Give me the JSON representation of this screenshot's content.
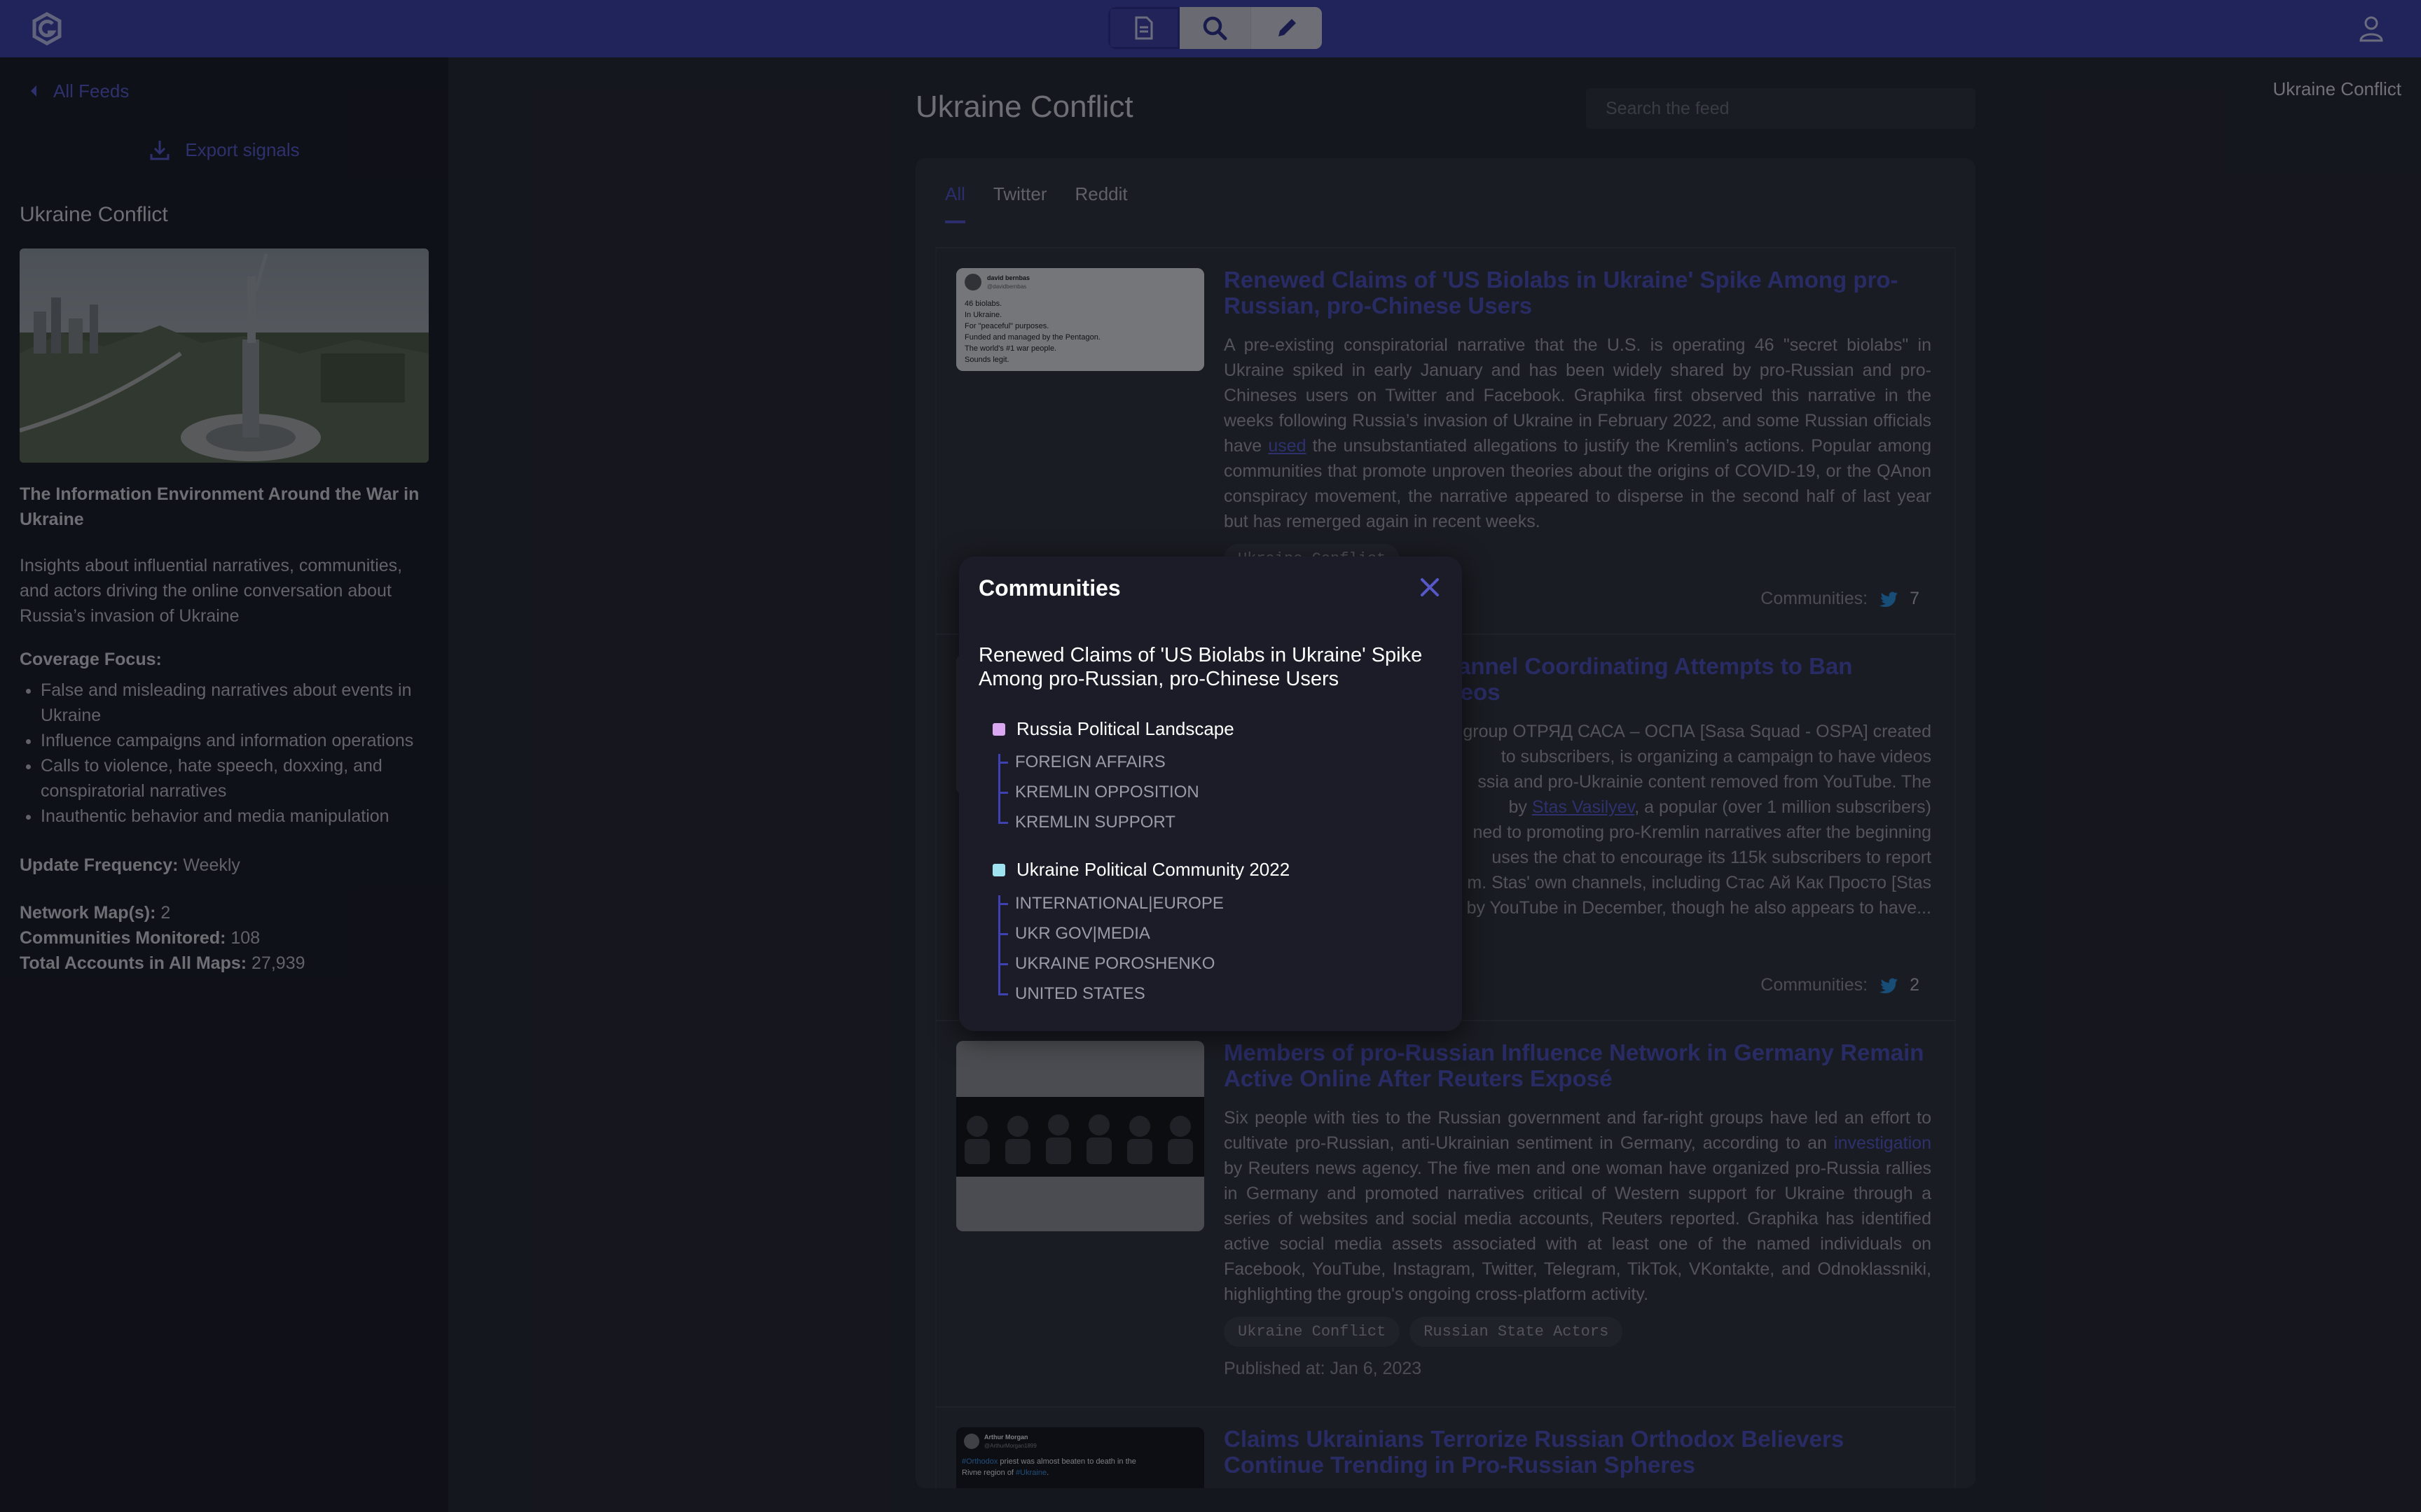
{
  "header": {
    "modes": [
      {
        "name": "document",
        "icon": "document-icon"
      },
      {
        "name": "search",
        "icon": "search-icon"
      },
      {
        "name": "edit",
        "icon": "pencil-icon"
      }
    ]
  },
  "sidebar": {
    "back_label": "All Feeds",
    "current_feed": "Ukraine Conflict",
    "export_label": "Export signals",
    "title": "Ukraine Conflict",
    "heading": "The Information Environment Around the War in Ukraine",
    "description": "Insights about influential narratives, communities, and actors driving the online conversation about Russia’s invasion of Ukraine",
    "coverage_title": "Coverage Focus:",
    "coverage_items": [
      "False and misleading narratives about events in Ukraine",
      "Influence campaigns and information operations",
      "Calls to violence, hate speech, doxxing, and conspiratorial narratives",
      "Inauthentic behavior and media manipulation"
    ],
    "frequency_label": "Update Frequency:",
    "frequency_value": "Weekly",
    "stats": [
      {
        "label": "Network Map(s):",
        "value": "2"
      },
      {
        "label": "Communities Monitored:",
        "value": "108"
      },
      {
        "label": "Total Accounts in All Maps:",
        "value": "27,939"
      }
    ]
  },
  "main": {
    "title": "Ukraine Conflict",
    "search_placeholder": "Search the feed",
    "tabs": [
      "All",
      "Twitter",
      "Reddit"
    ],
    "communities_label": "Communities:",
    "cards": [
      {
        "title": "Renewed Claims of 'US Biolabs in Ukraine' Spike Among pro-Russian, pro-Chinese Users",
        "body_pre": "A pre-existing conspiratorial narrative that the U.S. is operating 46 \"secret biolabs\" in Ukraine spiked in early January and has been widely shared by pro-Russian and pro-Chineses users on Twitter and Facebook. Graphika first observed this narrative in the weeks following Russia’s invasion of Ukraine in February 2022, and some Russian officials have ",
        "body_link": "used",
        "body_post": " the unsubstantiated allegations to justify the Kremlin’s actions. Popular among communities that promote unproven theories about the origins of COVID-19, or the QAnon conspiracy movement, the narrative appeared to disperse in the second half of last year but has remerged again in recent weeks.",
        "tags": [
          "Ukraine Conflict"
        ],
        "communities_count": "7",
        "tweet": {
          "author": "david bernbas",
          "handle": "@davidbernbas",
          "lines": [
            "46 biolabs.",
            "In Ukraine.",
            "For \"peaceful\" purposes.",
            "Funded and managed by the Pentagon.",
            "The world's #1 war people.",
            "Sounds legit."
          ]
        }
      },
      {
        "title_visible": "Channel Coordinating Attempts to Ban",
        "title_visible_2": "videos",
        "body_lines": [
          "group ОТРЯД САСА – ОСПА [Sasa Squad - OSPA] created",
          "to subscribers, is organizing a campaign to have videos",
          "ssia and pro-Ukrainie content removed from YouTube. The"
        ],
        "body_line4_pre": "by ",
        "body_line4_link": "Stas Vasilyev",
        "body_line4_post": ", a popular (over 1 million subscribers)",
        "body_lines_end": [
          "ned to promoting pro-Kremlin narratives after the beginning",
          "uses the chat to encourage its 115k subscribers to report",
          "m. Stas' own channels, including Стас Ай Как Просто [Stas",
          "by YouTube in December, though he also appears to have..."
        ],
        "communities_count": "2"
      },
      {
        "title": "Members of pro-Russian Influence Network in Germany Remain Active Online After Reuters Exposé",
        "body_pre": "Six people with ties to the Russian government and far-right groups have led an effort to cultivate pro-Russian, anti-Ukrainian sentiment in Germany, according to an ",
        "body_link": "investigation",
        "body_post": " by Reuters news agency. The five men and one woman have organized pro-Russia rallies in Germany and promoted narratives critical of Western support for Ukraine through a series of websites and social media accounts, Reuters reported. Graphika has identified active social media assets associated with at least one of the named individuals on Facebook, YouTube, Instagram, Twitter, Telegram, TikTok, VKontakte, and Odnoklassniki, highlighting the group's ongoing cross-platform activity.",
        "tags": [
          "Ukraine Conflict",
          "Russian State Actors"
        ],
        "published": "Published at: Jan 6, 2023"
      },
      {
        "title": "Claims Ukrainians Terrorize Russian Orthodox Believers Continue Trending in Pro-Russian Spheres",
        "tweet": {
          "author": "Arthur Morgan",
          "handle": "@ArthurMorgan1899",
          "line1_tag": "#Orthodox",
          "line1_rest": " priest was almost beaten to death in the",
          "line2_pre": "Rivne region of ",
          "line2_tag": "#Ukraine",
          "line2_post": "."
        }
      }
    ]
  },
  "modal": {
    "title": "Communities",
    "subtitle": "Renewed Claims of 'US Biolabs in Ukraine' Spike Among pro-Russian, pro-Chinese Users",
    "groups": [
      {
        "name": "Russia Political Landscape",
        "color": "#d9a8f0",
        "items": [
          "FOREIGN AFFAIRS",
          "KREMLIN OPPOSITION",
          "KREMLIN SUPPORT"
        ]
      },
      {
        "name": "Ukraine Political Community 2022",
        "color": "#9fe3f0",
        "items": [
          "INTERNATIONAL|EUROPE",
          "UKR GOV|MEDIA",
          "UKRAINE POROSHENKO",
          "UNITED STATES"
        ]
      }
    ]
  }
}
